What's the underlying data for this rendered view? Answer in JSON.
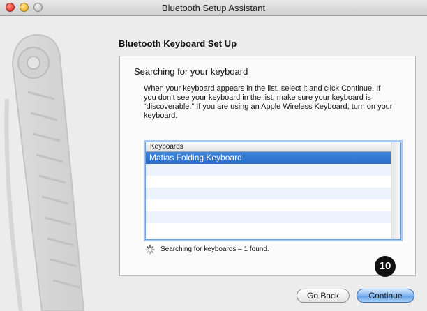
{
  "window": {
    "title": "Bluetooth Setup Assistant"
  },
  "page": {
    "heading": "Bluetooth Keyboard Set Up",
    "panel_title": "Searching for your keyboard",
    "description": "When your keyboard appears in the list, select it and click Continue. If you don’t see your keyboard in the list, make sure your keyboard is “discoverable.”  If you are using an Apple Wireless Keyboard, turn on your keyboard."
  },
  "list": {
    "header": "Keyboards",
    "items": [
      "Matias Folding Keyboard",
      "",
      "",
      "",
      "",
      "",
      ""
    ],
    "selected_index": 0
  },
  "status": {
    "text": "Searching for keyboards – 1 found."
  },
  "badge": {
    "number": "10"
  },
  "buttons": {
    "back": "Go Back",
    "continue": "Continue"
  },
  "colors": {
    "selection": "#2f74d0",
    "default_button": "#6fa9ec"
  }
}
